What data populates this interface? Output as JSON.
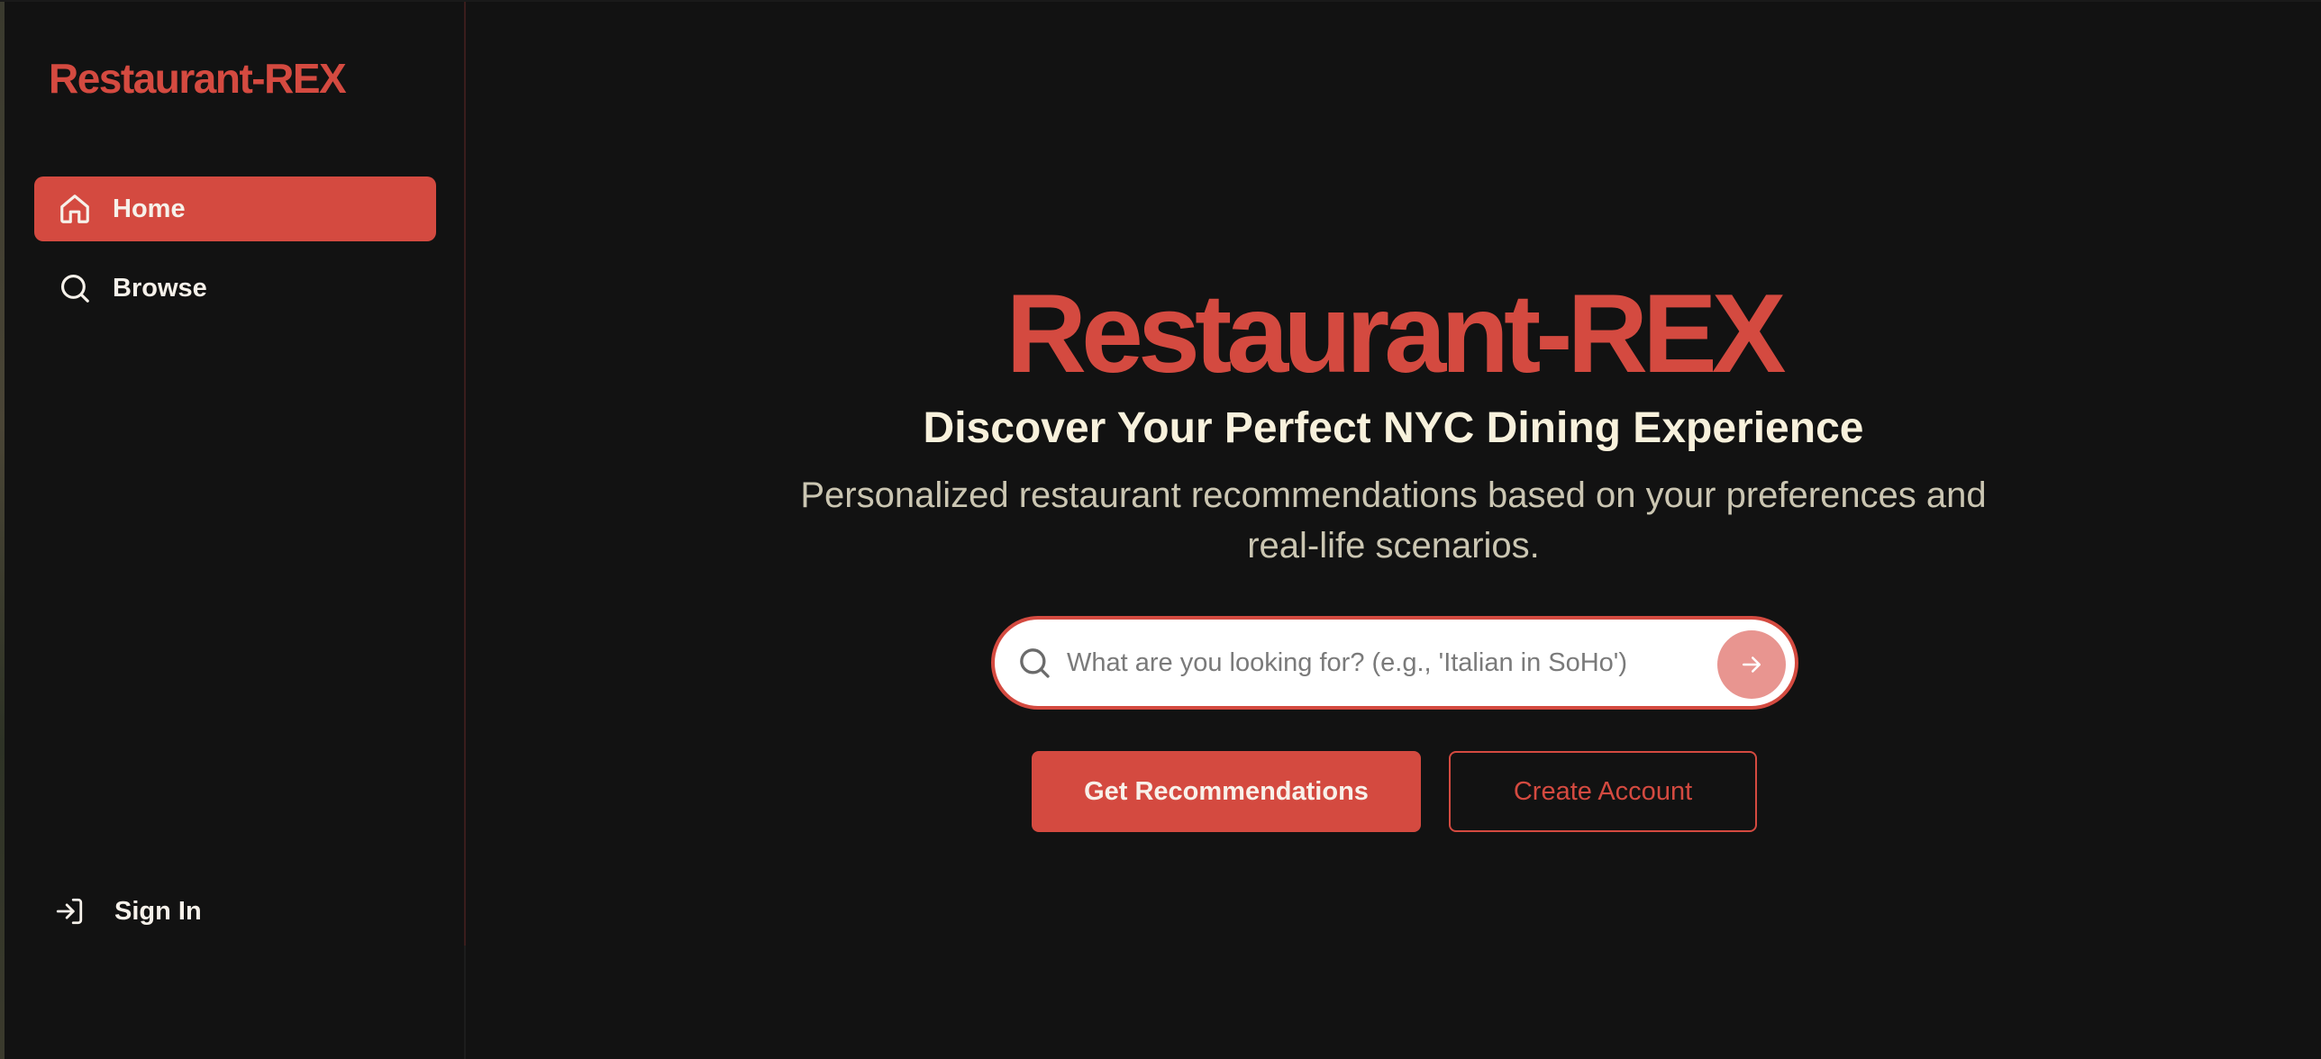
{
  "sidebar": {
    "brand": "Restaurant-REX",
    "items": [
      {
        "label": "Home",
        "icon": "home-icon",
        "active": true
      },
      {
        "label": "Browse",
        "icon": "search-icon",
        "active": false
      }
    ],
    "signin": {
      "label": "Sign In",
      "icon": "sign-in-icon"
    }
  },
  "hero": {
    "title": "Restaurant-REX",
    "subtitle": "Discover Your Perfect NYC Dining Experience",
    "description": "Personalized restaurant recommendations based on your preferences and real-life scenarios."
  },
  "search": {
    "placeholder": "What are you looking for? (e.g., 'Italian in SoHo')",
    "value": "",
    "submit_icon": "arrow-right-icon"
  },
  "actions": {
    "primary_label": "Get Recommendations",
    "secondary_label": "Create Account"
  },
  "colors": {
    "accent": "#d44a40",
    "background": "#121212",
    "title_text": "#f8f1dc",
    "body_text": "#cbc6b2"
  }
}
